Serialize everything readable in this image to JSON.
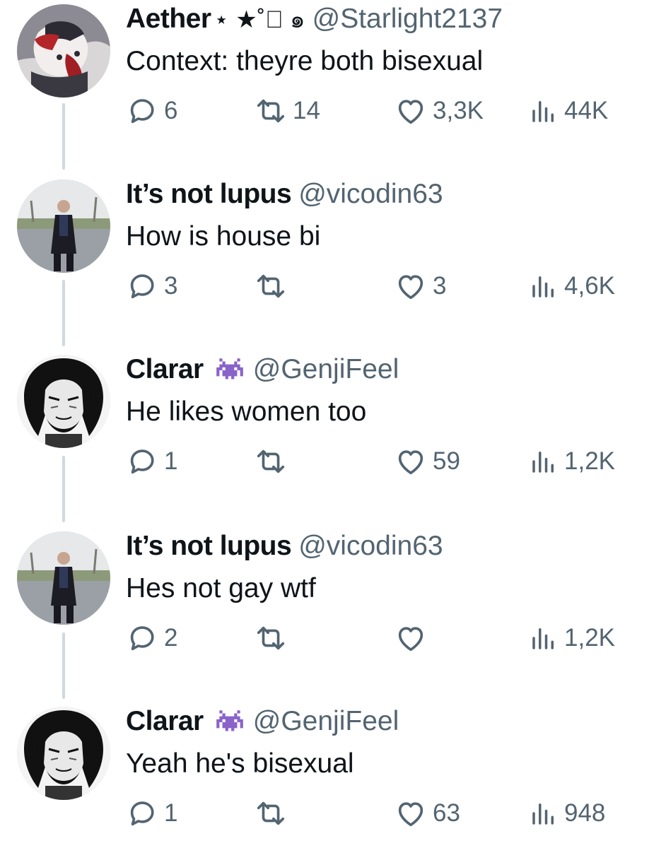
{
  "tweets": [
    {
      "display_name": "Aether",
      "name_decoration": "⋆ ★˚⃝ ๑",
      "handle": "@Starlight2137",
      "text": "Context: theyre both bisexual",
      "replies": "6",
      "retweets": "14",
      "likes": "3,3K",
      "views": "44K",
      "avatar_icon": "anime-avatar-red"
    },
    {
      "display_name": "It’s not lupus",
      "handle": "@vicodin63",
      "text": "How is house bi",
      "replies": "3",
      "retweets": "",
      "likes": "3",
      "views": "4,6K",
      "avatar_icon": "man-walking-photo"
    },
    {
      "display_name": "Clarar",
      "handle": "@GenjiFeel",
      "text": "He likes women too",
      "replies": "1",
      "retweets": "",
      "likes": "59",
      "views": "1,2K",
      "avatar_icon": "manga-avatar"
    },
    {
      "display_name": "It’s not lupus",
      "handle": "@vicodin63",
      "text": "Hes not gay wtf",
      "replies": "2",
      "retweets": "",
      "likes": "",
      "views": "1,2K",
      "avatar_icon": "man-walking-photo"
    },
    {
      "display_name": "Clarar",
      "handle": "@GenjiFeel",
      "text": "Yeah he's bisexual",
      "replies": "1",
      "retweets": "",
      "likes": "63",
      "views": "948",
      "avatar_icon": "manga-avatar"
    }
  ],
  "colors": {
    "text": "#0f1419",
    "secondary": "#536471",
    "thread_line": "#cfd9de",
    "emoji_purple": "#8a63c9"
  }
}
